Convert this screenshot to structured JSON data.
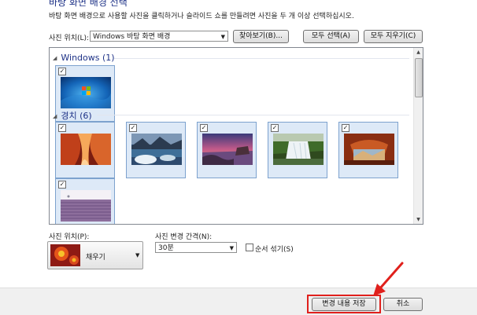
{
  "header": {
    "title": "바탕 화면 배경 선택",
    "description": "바탕 화면 배경으로 사용할 사진을 클릭하거나 슬라이드 쇼를 만들려면 사진을 두 개 이상 선택하십시오."
  },
  "location": {
    "label": "사진 위치(L):",
    "value": "Windows 바탕 화면 배경",
    "browse_label": "찾아보기(B)...",
    "select_all_label": "모두 선택(A)",
    "clear_all_label": "모두 지우기(C)"
  },
  "groups": [
    {
      "label": "Windows (1)",
      "items": [
        {
          "name": "windows-default",
          "checked": true
        }
      ]
    },
    {
      "label": "경치 (6)",
      "items": [
        {
          "name": "canyon",
          "checked": true
        },
        {
          "name": "ice-lake",
          "checked": true
        },
        {
          "name": "coast-sunset",
          "checked": true
        },
        {
          "name": "waterfall",
          "checked": true
        },
        {
          "name": "rock-arch",
          "checked": true
        },
        {
          "name": "lavender-field",
          "checked": true
        }
      ]
    }
  ],
  "picture_position": {
    "label": "사진 위치(P):",
    "value": "채우기"
  },
  "interval": {
    "label": "사진 변경 간격(N):",
    "value": "30분"
  },
  "shuffle": {
    "label": "순서 섞기(S)",
    "checked": false
  },
  "footer": {
    "save_label": "변경 내용 저장",
    "cancel_label": "취소"
  },
  "annotation": {
    "color": "#e0201c"
  }
}
